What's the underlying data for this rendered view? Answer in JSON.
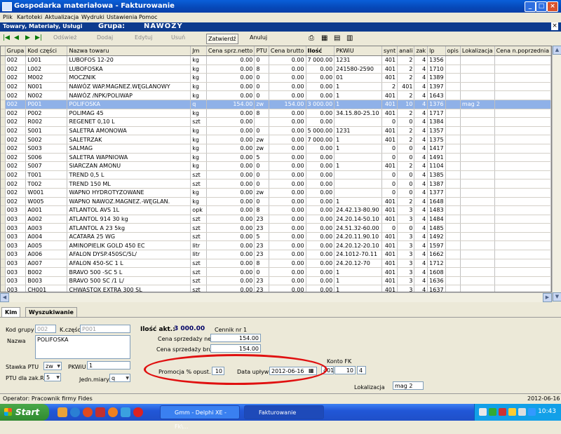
{
  "window": {
    "title": "Gospodarka materiałowa - Fakturowanie"
  },
  "menu": [
    "Plik",
    "Kartoteki",
    "Aktualizacja",
    "Wydruki",
    "Ustawienia",
    "Pomoc"
  ],
  "header": {
    "section": "Towary, Materiały, Usługi",
    "group_label": "Grupa:",
    "group_value": "NAWOZY"
  },
  "toolbar": {
    "edit": "Odśwież",
    "add": "Dodaj",
    "modify": "Edytuj",
    "delete": "Usuń",
    "confirm": "Zatwierdź",
    "cancel": "Anuluj"
  },
  "grid": {
    "columns": [
      "Grupa",
      "Kod części",
      "Nazwa towaru",
      "Jm",
      "Cena sprz.netto",
      "PTU",
      "Cena brutto",
      "Ilość",
      "PKWiU",
      "synt",
      "anali",
      "zak",
      "lp",
      "opis",
      "Lokalizacja",
      "Cena n.poprzednia"
    ],
    "rows": [
      [
        "002",
        "L001",
        "LUBOFOS 12-20",
        "kg",
        "0.00",
        "0",
        "0.00",
        "7 000.00",
        "1231",
        "401",
        "2",
        "4",
        "1356",
        "",
        "",
        ""
      ],
      [
        "002",
        "L002",
        "LUBOFOSKA",
        "kg",
        "0.00",
        "8",
        "0.00",
        "0.00",
        "241580-2590",
        "401",
        "2",
        "4",
        "1710",
        "",
        "",
        ""
      ],
      [
        "002",
        "M002",
        "MOCZNIK",
        "kg",
        "0.00",
        "0",
        "0.00",
        "0.00",
        "01",
        "401",
        "2",
        "4",
        "1389",
        "",
        "",
        ""
      ],
      [
        "002",
        "N001",
        "NAWÓZ WAP.MAGNEZ.WĘGLANOWY",
        "kg",
        "0.00",
        "0",
        "0.00",
        "0.00",
        "1",
        "2",
        "401",
        "4",
        "1397",
        "",
        "",
        ""
      ],
      [
        "002",
        "N002",
        "NAWÓZ /NPK/POLIWAP",
        "kg",
        "0.00",
        "0",
        "0.00",
        "0.00",
        "1",
        "401",
        "2",
        "4",
        "1643",
        "",
        "",
        ""
      ],
      [
        "002",
        "P001",
        "POLIFOSKA",
        "q",
        "154.00",
        "zw",
        "154.00",
        "3 000.00",
        "1",
        "401",
        "10",
        "4",
        "1376",
        "",
        "mag 2",
        ""
      ],
      [
        "002",
        "P002",
        "POLIMAG 45",
        "kg",
        "0.00",
        "8",
        "0.00",
        "0.00",
        "34.15.80-25.10",
        "401",
        "2",
        "4",
        "1717",
        "",
        "",
        ""
      ],
      [
        "002",
        "R002",
        "REGENET 0,10 L",
        "szt",
        "0.00",
        "",
        "0.00",
        "0.00",
        "",
        "0",
        "0",
        "4",
        "1384",
        "",
        "",
        ""
      ],
      [
        "002",
        "S001",
        "SALETRA AMONOWA",
        "kg",
        "0.00",
        "0",
        "0.00",
        "5 000.00",
        "1231",
        "401",
        "2",
        "4",
        "1357",
        "",
        "",
        ""
      ],
      [
        "002",
        "S002",
        "SALETRZAK",
        "kg",
        "0.00",
        "zw",
        "0.00",
        "7 000.00",
        "1",
        "401",
        "2",
        "4",
        "1375",
        "",
        "",
        ""
      ],
      [
        "002",
        "S003",
        "SALMAG",
        "kg",
        "0.00",
        "zw",
        "0.00",
        "0.00",
        "1",
        "0",
        "0",
        "4",
        "1417",
        "",
        "",
        ""
      ],
      [
        "002",
        "S006",
        "SALETRA WAPNIOWA",
        "kg",
        "0.00",
        "5",
        "0.00",
        "0.00",
        "",
        "0",
        "0",
        "4",
        "1491",
        "",
        "",
        ""
      ],
      [
        "002",
        "S007",
        "SIARCZAN AMONU",
        "kg",
        "0.00",
        "0",
        "0.00",
        "0.00",
        "1",
        "401",
        "2",
        "4",
        "1104",
        "",
        "",
        ""
      ],
      [
        "002",
        "T001",
        "TREND 0,5 L",
        "szt",
        "0.00",
        "0",
        "0.00",
        "0.00",
        "",
        "0",
        "0",
        "4",
        "1385",
        "",
        "",
        ""
      ],
      [
        "002",
        "T002",
        "TREND 150 ML",
        "szt",
        "0.00",
        "0",
        "0.00",
        "0.00",
        "",
        "0",
        "0",
        "4",
        "1387",
        "",
        "",
        ""
      ],
      [
        "002",
        "W001",
        "WAPNO HYDROTYZOWANE",
        "kg",
        "0.00",
        "zw",
        "0.00",
        "0.00",
        "",
        "0",
        "0",
        "4",
        "1377",
        "",
        "",
        ""
      ],
      [
        "002",
        "W005",
        "WAPNO NAWOZ.MAGNEZ.-WĘGLAN.",
        "kg",
        "0.00",
        "0",
        "0.00",
        "0.00",
        "1",
        "401",
        "2",
        "4",
        "1648",
        "",
        "",
        ""
      ],
      [
        "003",
        "A001",
        "ATLANTOL AVS 1L",
        "opk",
        "0.00",
        "8",
        "0.00",
        "0.00",
        "24.42.13-80.90",
        "401",
        "3",
        "4",
        "1483",
        "",
        "",
        ""
      ],
      [
        "003",
        "A002",
        "ATLANTOL 914 30 kg",
        "szt",
        "0.00",
        "23",
        "0.00",
        "0.00",
        "24.20.14-50.10",
        "401",
        "3",
        "4",
        "1484",
        "",
        "",
        ""
      ],
      [
        "003",
        "A003",
        "ATLANTOL A 23 5kg",
        "szt",
        "0.00",
        "23",
        "0.00",
        "0.00",
        "24.51.32-60.00",
        "0",
        "0",
        "4",
        "1485",
        "",
        "",
        ""
      ],
      [
        "003",
        "A004",
        "ACATARA 25 WG",
        "szt",
        "0.00",
        "5",
        "0.00",
        "0.00",
        "24.20.11.90.10",
        "401",
        "3",
        "4",
        "1492",
        "",
        "",
        ""
      ],
      [
        "003",
        "A005",
        "AMINOPIELIK GOLD 450 EC",
        "litr",
        "0.00",
        "23",
        "0.00",
        "0.00",
        "24.20.12-20.10",
        "401",
        "3",
        "4",
        "1597",
        "",
        "",
        ""
      ],
      [
        "003",
        "A006",
        "AFALON DYSP.450SC/5L/",
        "litr",
        "0.00",
        "23",
        "0.00",
        "0.00",
        "24.1012-70.11",
        "401",
        "3",
        "4",
        "1662",
        "",
        "",
        ""
      ],
      [
        "003",
        "A007",
        "AFALON 450-SC 1 L",
        "szt",
        "0.00",
        "8",
        "0.00",
        "0.00",
        "24.20.12-70",
        "401",
        "3",
        "4",
        "1712",
        "",
        "",
        ""
      ],
      [
        "003",
        "B002",
        "BRAVO 500 -SC 5 L",
        "szt",
        "0.00",
        "0",
        "0.00",
        "0.00",
        "1",
        "401",
        "3",
        "4",
        "1608",
        "",
        "",
        ""
      ],
      [
        "003",
        "B003",
        "BRAVO 500 SC /1 L/",
        "szt",
        "0.00",
        "23",
        "0.00",
        "0.00",
        "1",
        "401",
        "3",
        "4",
        "1636",
        "",
        "",
        ""
      ],
      [
        "003",
        "CH001",
        "CHWASTOX EXTRA 300 SL",
        "szt",
        "0.00",
        "23",
        "0.00",
        "0.00",
        "1",
        "401",
        "3",
        "4",
        "1637",
        "",
        "",
        ""
      ]
    ]
  },
  "tabs": [
    "Kim",
    "Wyszukiwanie"
  ],
  "form": {
    "kod_grupy_label": "Kod grupy",
    "kod_grupy_value": "002",
    "kod_czesci_label": "K.części",
    "kod_czesci_value": "P001",
    "nazwa_label": "Nazwa",
    "nazwa_value": "POLIFOSKA",
    "ilosc_label": "Ilość akt.:",
    "ilosc_value": "3 000.00",
    "cennik_label": "Cennik nr 1",
    "netto_label": "Cena sprzedaży netto",
    "netto_value": "154.00",
    "brutto_label": "Cena sprzedaży brutto",
    "brutto_value": "154.00",
    "stawka_label": "Stawka PTU",
    "stawka_value": "zw",
    "pkwiu_label": "PKWiU",
    "pkwiu_value": "1",
    "ptu_rr_label": "PTU dla zak.RR",
    "ptu_rr_value": "5",
    "jm_label": "Jedn.miary",
    "jm_value": "q",
    "promocja_label": "Promocja % opust.",
    "promocja_value": "10",
    "data_label": "Data upływu",
    "data_value": "2012-06-16",
    "konto_label": "Konto FK",
    "konto_1": "401",
    "konto_2": "10",
    "konto_3": "4",
    "lokalizacja_label": "Lokalizacja",
    "lokalizacja_value": "mag 2"
  },
  "status": {
    "operator": "Operator: Pracownik firmy Fides",
    "date": "2012-06-16"
  },
  "taskbar": {
    "start": "Start",
    "task1": "Gmm - Delphi XE - Fk\\...",
    "task2": "Fakturowanie",
    "clock": "10:43"
  },
  "colors": {
    "title": "#0648b8",
    "selection": "#8fb1e8",
    "highlight_oval": "#e01010"
  }
}
